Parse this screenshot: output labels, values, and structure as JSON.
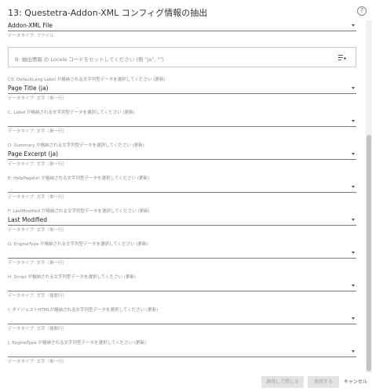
{
  "dialog": {
    "title": "13: Questetra-Addon-XML コンフィグ情報の抽出",
    "help_icon_label": "?"
  },
  "fields": [
    {
      "label": "",
      "value": "Addon-XML File",
      "hint": "データタイプ: ファイル"
    }
  ],
  "locale_input": {
    "placeholder": "B: 抽出情報 の Locale コードをセットしてください (例 \"ja\", \"\")"
  },
  "mappings": [
    {
      "label": "C0: DefaultLang Label が格納される文字列型データを選択してください (更新)",
      "value": "Page Title (ja)",
      "hint": "データタイプ: 文字（単一行）"
    },
    {
      "label": "C: Label が格納される文字列型データを選択してください (更新)",
      "value": "",
      "hint": "データタイプ: 文字（単一行）"
    },
    {
      "label": "D: Summary が格納される文字列型データを選択してください (更新)",
      "value": "Page Excerpt (ja)",
      "hint": "データタイプ: 文字（単一行）"
    },
    {
      "label": "E: HelpPageUrl が格納される文字列型データを選択してください (更新)",
      "value": "",
      "hint": "データタイプ: 文字（単一行）"
    },
    {
      "label": "F: LastModified が格納される文字列型データを選択してください (更新)",
      "value": "Last Modified",
      "hint": "データタイプ: 文字（単一行）"
    },
    {
      "label": "G: EngineType が格納される文字列型データを選択してください (更新)",
      "value": "",
      "hint": "データタイプ: 文字（単一行）"
    },
    {
      "label": "H: Script が格納される文字列型データを選択してください (更新)",
      "value": "",
      "hint": "データタイプ: 文字（複数行）"
    },
    {
      "label": "I: ダイジェストHTMLが格納される文字列型データを選択してください (更新)",
      "value": "",
      "hint": "データタイプ: 文字（複数行）"
    },
    {
      "label": "J: EngineType が格納される文字列型データを選択してください (更新)",
      "value": "",
      "hint": "データタイプ: 文字（単一行）"
    }
  ],
  "footer": {
    "apply_close_label": "適用して閉じる",
    "apply_label": "適用する",
    "cancel_label": "キャンセル"
  },
  "colors": {
    "accent": "#555555",
    "disabled_button": "#e3e3e3"
  }
}
